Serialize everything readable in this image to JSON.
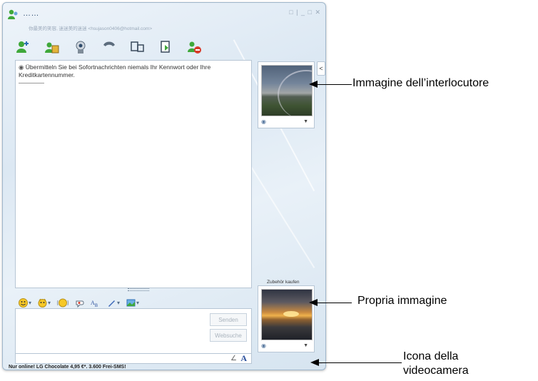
{
  "window": {
    "contact_name": "……",
    "personal_message": "你最美的笑容, 迷迷美的迷迷 <hsujason0406@hotmail.com>",
    "controls": "□ | _ □ ✕"
  },
  "toolbar": {
    "buttons": [
      "invite-icon",
      "share-files-icon",
      "video-call-icon",
      "voice-call-icon",
      "activities-icon",
      "games-icon",
      "block-icon"
    ]
  },
  "chat": {
    "security_notice": "Übermitteln Sie bei Sofortnachrichten niemals Ihr Kennwort oder Ihre Kreditkartennummer."
  },
  "compose": {
    "send_label": "Senden",
    "search_label": "Websuche"
  },
  "formatting": {
    "items": [
      "emoticons-icon",
      "winks-icon",
      "nudge-icon",
      "voice-clip-icon",
      "font-icon",
      "handwriting-icon",
      "background-icon"
    ]
  },
  "sidebar": {
    "accessory_link": "Zubehör kaufen",
    "collapse_glyph": "<"
  },
  "status": {
    "text": "Nur online! LG Chocolate 4,95 €*. 3.600 Frei-SMS!"
  },
  "annotations": {
    "contact_picture": "Immagine dell’interlocutore",
    "own_picture": "Propria immagine",
    "webcam_icon_line1": "Icona della",
    "webcam_icon_line2": "videocamera"
  },
  "colors": {
    "accent": "#2c4a6e",
    "frame_border": "#b7c6d5"
  }
}
